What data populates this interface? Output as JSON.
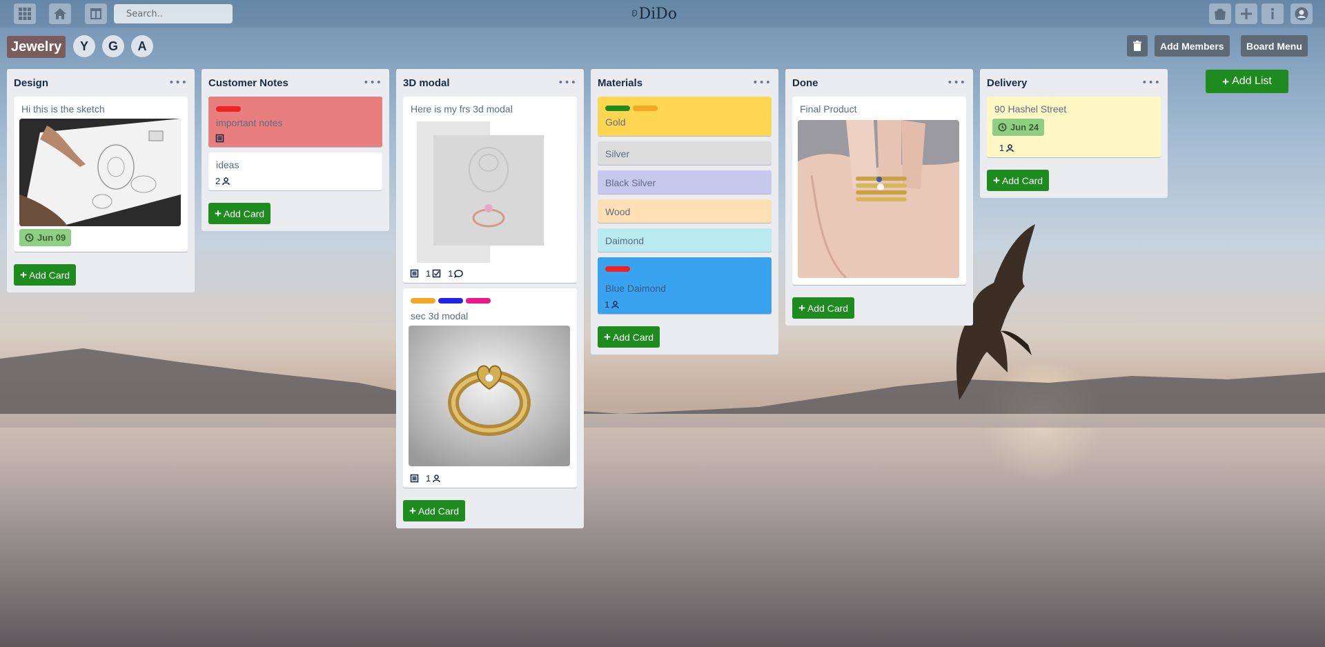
{
  "topbar": {
    "search_placeholder": "Search..",
    "logo_text": "DiDo"
  },
  "board": {
    "title": "Jewelry",
    "members": [
      "Y",
      "G",
      "A"
    ],
    "add_members_label": "Add Members",
    "board_menu_label": "Board Menu",
    "add_list_label": "Add List"
  },
  "add_card_label": "Add Card",
  "lists": [
    {
      "title": "Design",
      "cards": [
        {
          "title": "Hi this is the sketch",
          "due": "Jun 09"
        }
      ]
    },
    {
      "title": "Customer Notes",
      "cards": [
        {
          "title": "important notes",
          "color": "#e87e7e",
          "labels": [
            "#ee2222"
          ]
        },
        {
          "title": "ideas",
          "members": "2"
        }
      ]
    },
    {
      "title": "3D modal",
      "cards": [
        {
          "title": "Here is my frs 3d modal",
          "checklist": "1",
          "comments": "1"
        },
        {
          "title": "sec 3d modal",
          "labels": [
            "#f5a623",
            "#2222ee",
            "#f0168c"
          ],
          "members": "1"
        }
      ]
    },
    {
      "title": "Materials",
      "cards": [
        {
          "title": "Gold",
          "color": "#fed652",
          "labels": [
            "#1e8b1e",
            "#f5a623"
          ]
        },
        {
          "title": "Silver",
          "color": "#dcdcdc"
        },
        {
          "title": "Black Silver",
          "color": "#c6c8ec"
        },
        {
          "title": "Wood",
          "color": "#fee0b4"
        },
        {
          "title": "Daimond",
          "color": "#b8eaf0"
        },
        {
          "title": "Blue Daimond",
          "color": "#3aa3f0",
          "labels": [
            "#ee2222"
          ],
          "members": "1"
        }
      ]
    },
    {
      "title": "Done",
      "cards": [
        {
          "title": "Final Product"
        }
      ]
    },
    {
      "title": "Delivery",
      "cards": [
        {
          "title": "90 Hashel Street",
          "color": "#fff7c4",
          "due": "Jun 24",
          "members": "1"
        }
      ]
    }
  ],
  "colors": {
    "add_button": "#1e8b1e",
    "list_background": "#ebecf0",
    "due_badge": "#8fcf84"
  }
}
